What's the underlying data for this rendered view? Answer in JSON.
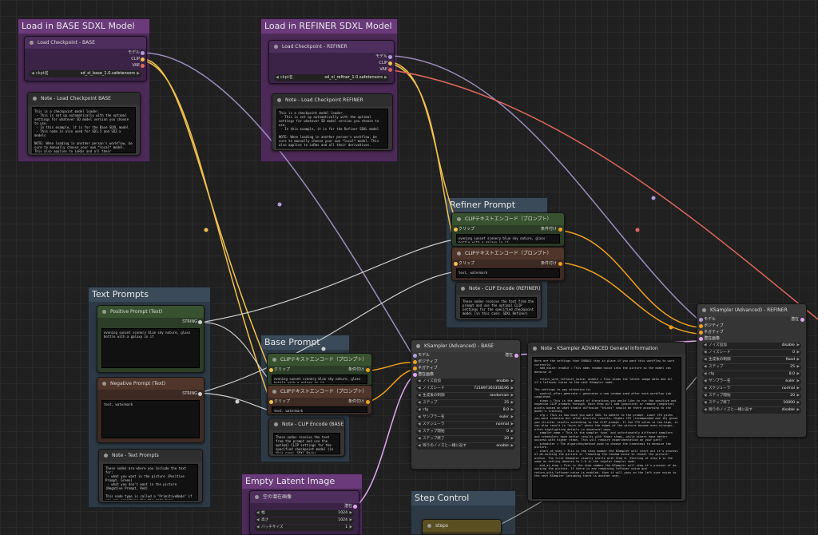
{
  "groups": {
    "base_model": "Load in BASE SDXL Model",
    "refiner_model": "Load in REFINER SDXL Model",
    "refiner_prompt": "Refiner Prompt",
    "text_prompts": "Text Prompts",
    "base_prompt": "Base Prompt",
    "empty_latent": "Empty Latent Image",
    "step_control": "Step Control"
  },
  "load_base": {
    "title": "Load Checkpoint - BASE",
    "out_model": "モデル",
    "out_clip": "CLIP",
    "out_vae": "VAE",
    "ckpt_label": "ckpt名",
    "ckpt_value": "sd_xl_base_1.0.safetensors"
  },
  "note_base": {
    "title": "Note - Load Checkpoint BASE",
    "text": "This is a checkpoint model loader.\n - This is set up automatically with the optimal settings for whatever SD model version you choose to use.\n - In this example, it is for the Base SDXL model\n - This node is also used for SD1.5 and SD2.x models\n\nNOTE: When loading in another person's workflow, be sure to manually choose your own *local* model. This also applies to LoRas and all their derivatives."
  },
  "load_refiner": {
    "title": "Load Checkpoint - REFINER",
    "out_model": "モデル",
    "out_clip": "CLIP",
    "out_vae": "VAE",
    "ckpt_label": "ckpt名",
    "ckpt_value": "sd_xl_refiner_1.0.safetensors"
  },
  "note_refiner": {
    "title": "Note - Load Checkpoint REFINER",
    "text": "This is a checkpoint model loader.\n - This is set up automatically with the optimal settings for whatever SD model version you choose to use.\n - In this example, it is for the Refiner SDXL model\n\nNOTE: When loading in another person's workflow, be sure to manually choose your own *local* model. This also applies to LoRas and all their derivatives."
  },
  "refiner_clip_pos": {
    "title": "CLIPテキストエンコード（プロンプト）",
    "in": "クリップ",
    "out": "条件付け",
    "text": "evening sunset scenery blue sky nature, glass bottle with a galaxy in it"
  },
  "refiner_clip_neg": {
    "title": "CLIPテキストエンコード（プロンプト）",
    "in": "クリップ",
    "out": "条件付け",
    "text": "text, watermark"
  },
  "note_clip_refiner": {
    "title": "Note - CLIP Encode (REFINER)",
    "text": "These nodes receive the text from the prompt and use the optimal CLIP settings for the specified checkpoint model (in this case: SDXL Refiner)"
  },
  "positive_prompt": {
    "title": "Positive Prompt (Text)",
    "out": "STRING",
    "text": "evening sunset scenery blue sky nature, glass bottle with a galaxy in it"
  },
  "negative_prompt": {
    "title": "Negative Prompt (Text)",
    "out": "STRING",
    "text": "text, watermark"
  },
  "note_text": {
    "title": "Note - Text Prompts",
    "text": "These nodes are where you include the text for:\n - what you want in the picture (Positive Prompt, Green)\n - what you don't want in the picture (Negative Prompt, Red)\n\nThis node type is called a \"PrimitiveNode\" if you are searching for the node type."
  },
  "base_clip_pos": {
    "title": "CLIPテキストエンコード（プロンプト）",
    "in": "クリップ",
    "out": "条件付け",
    "text": "evening sunset scenery blue sky nature, glass bottle with a galaxy in it"
  },
  "base_clip_neg": {
    "title": "CLIPテキストエンコード（プロンプト）",
    "in": "クリップ",
    "out": "条件付け",
    "text": "text, watermark"
  },
  "note_clip_base": {
    "title": "Note - CLIP Encode (BASE)",
    "text": "These nodes receive the text from the prompt and use the optimal CLIP settings for the specified checkpoint model (in this case: SDXL Base)"
  },
  "ksampler_base": {
    "title": "KSampler (Advanced) - BASE",
    "in_model": "モデル",
    "in_pos": "ポジティブ",
    "in_neg": "ネガティブ",
    "in_latent": "潜在画像",
    "out": "潜在",
    "widgets": [
      {
        "label": "ノイズ追加",
        "value": "enable"
      },
      {
        "label": "ノイズシード",
        "value": "721897303358196"
      },
      {
        "label": "生成後の制御",
        "value": "randomize"
      },
      {
        "label": "ステップ",
        "value": "25"
      },
      {
        "label": "cfg",
        "value": "8.0"
      },
      {
        "label": "サンプラー名",
        "value": "euler"
      },
      {
        "label": "スケジューラ",
        "value": "normal"
      },
      {
        "label": "ステップ開始",
        "value": "0"
      },
      {
        "label": "ステップ終了",
        "value": "20"
      },
      {
        "label": "残りのノイズと一緒に返す",
        "value": "enable"
      }
    ]
  },
  "note_ksampler": {
    "title": "Note - KSampler ADVANCED General Information",
    "text": "Here are the settings that SHOULD stay in place if you want this workflow to work correctly:\n - add_noise: enable = This adds random noise into the picture so the model can denoise it\n\n - return_with_leftover_noise: enable = This sends the latent image data and all it's leftover noise to the next KSampler node.\n\nThe settings to pay attention to:\n - control_after_generate = generates a new random seed after each workflow job completed.\n - steps = This is the amount of iterations you would like to run the positive and negative CLIP prompts through. Each Step will add (positive) or remove (negative) pixels based on what stable diffusion \"thinks\" should be there according to the model's training\n - cfg = This is how much you want SDXL to adhere to the prompt. Lower CFG gives you more creative but often blurrier results. Higher CFG (recommended max 10) gives you stricter results according to the CLIP prompt. If the CFG value is too high, it can also result in \"burn-in\" where the edges of the picture become even stronger, often highlighting details in unnatural ways.\n - sampler_name = This is the sampler type, and unfortunately different samplers and schedulers have better results with fewer steps, while others have better success with higher steps. This will require experimentation on your part!\n - scheduler = The algorithm/method used to choose the timesteps to denoise the picture.\n - start_at_step = This is the step number the KSampler will start out it's process of de-noising the picture or \"removing the random noise to reveal the picture\" within. The first KSampler usually starts with Step 0. Starting at step 0 is the same as setting denoise to 1.0 in the regular Sampler node.\n - end_at_step = This is the step number the KSampler will stop it's process of de-noising the picture. If there is any remaining leftover noise and return_with_leftover_noise is enabled, then it will pass on the left over noise to the next KSampler (assuming there is another one)."
  },
  "ksampler_refiner": {
    "title": "KSampler (Advanced) - REFINER",
    "in_model": "モデル",
    "in_pos": "ポジティブ",
    "in_neg": "ネガティブ",
    "in_latent": "潜在画像",
    "out": "潜在",
    "widgets": [
      {
        "label": "ノイズ追加",
        "value": "disable"
      },
      {
        "label": "ノイズシード",
        "value": "0"
      },
      {
        "label": "生成後の制御",
        "value": "fixed"
      },
      {
        "label": "ステップ",
        "value": "25"
      },
      {
        "label": "cfg",
        "value": "8.0"
      },
      {
        "label": "サンプラー名",
        "value": "euler"
      },
      {
        "label": "スケジューラ",
        "value": "normal"
      },
      {
        "label": "ステップ開始",
        "value": "20"
      },
      {
        "label": "ステップ終了",
        "value": "10000"
      },
      {
        "label": "残りのノイズと一緒に返す",
        "value": "disable"
      }
    ]
  },
  "empty_latent": {
    "title": "空の潜在画像",
    "out": "潜在",
    "widgets": [
      {
        "label": "幅",
        "value": "1024"
      },
      {
        "label": "高さ",
        "value": "1024"
      },
      {
        "label": "バッチサイズ",
        "value": "1"
      }
    ]
  },
  "steps_node": {
    "title": "steps"
  },
  "colors": {
    "clip_wire": "#f2c14e",
    "model_wire": "#b39ddb",
    "vae_wire": "#e0665a",
    "cond_wire": "#f0a020",
    "string_wire": "#cfcfcf",
    "latent_wire": "#e2a6f0"
  }
}
